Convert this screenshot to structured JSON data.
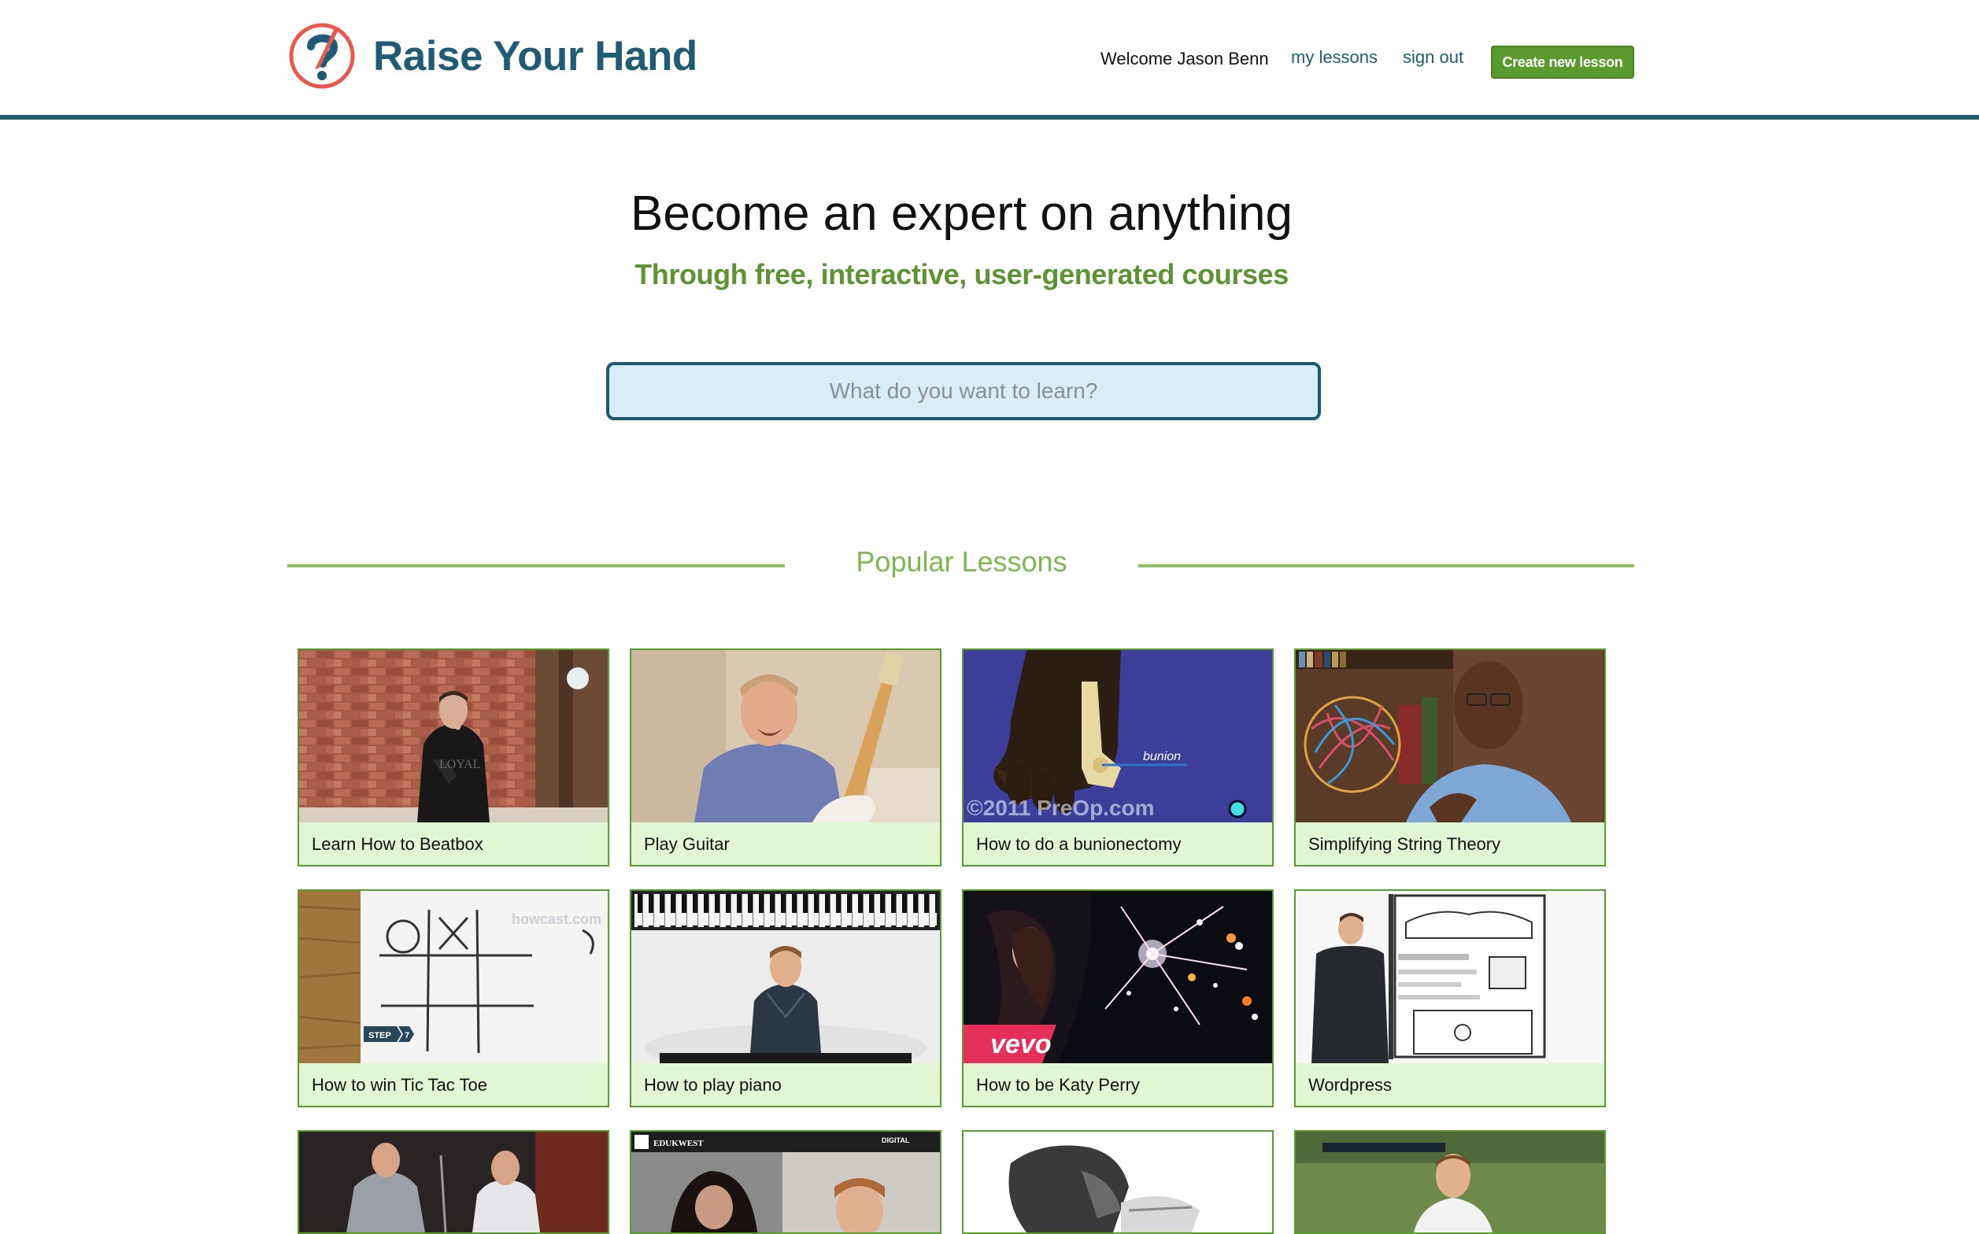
{
  "header": {
    "logo_text": "Raise Your Hand",
    "welcome": "Welcome Jason Benn",
    "my_lessons": "my lessons",
    "sign_out": "sign out",
    "create_button": "Create new lesson"
  },
  "hero": {
    "title": "Become an expert on anything",
    "subtitle": "Through free, interactive, user-generated courses"
  },
  "search": {
    "placeholder": "What do you want to learn?"
  },
  "popular": {
    "heading": "Popular Lessons",
    "lessons": [
      {
        "title": "Learn How to Beatbox"
      },
      {
        "title": "Play Guitar"
      },
      {
        "title": "How to do a bunionectomy"
      },
      {
        "title": "Simplifying String Theory"
      },
      {
        "title": "How to win Tic Tac Toe"
      },
      {
        "title": "How to play piano"
      },
      {
        "title": "How to be Katy Perry"
      },
      {
        "title": "Wordpress"
      },
      {
        "title": ""
      },
      {
        "title": ""
      },
      {
        "title": ""
      },
      {
        "title": ""
      }
    ],
    "thumb_text": {
      "bunion_label": "bunion",
      "preop_watermark": "©2011 PreOp.com",
      "howcast_watermark": "howcast.com",
      "step_badge": "STEP",
      "step_number": "7",
      "vevo": "vevo",
      "edukwest": "EDUKWEST",
      "digital": "DIGITAL"
    }
  },
  "colors": {
    "brand_blue": "#1d5a72",
    "brand_green": "#5a9a2e",
    "section_green": "#7cb84f",
    "logo_red": "#e9574f",
    "card_bg": "#e3f6d4",
    "search_bg": "#d7eef8"
  }
}
